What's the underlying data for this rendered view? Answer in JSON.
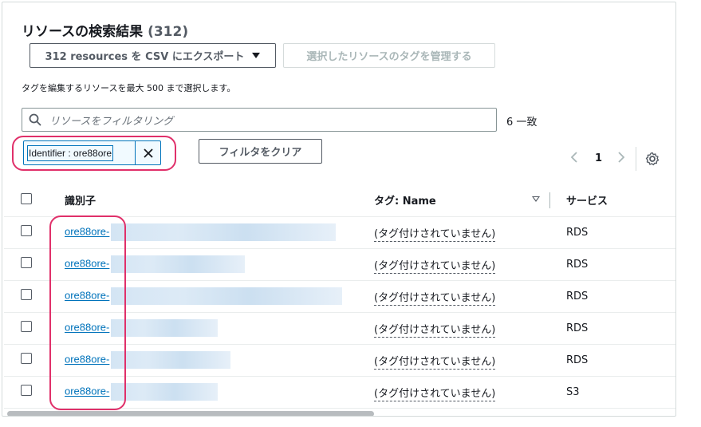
{
  "header": {
    "title": "リソースの検索結果",
    "count": "(312)"
  },
  "actions": {
    "export_label": "312 resources を CSV にエクスポート",
    "manage_tags_label": "選択したリソースのタグを管理する"
  },
  "hint": "タグを編集するリソースを最大 500 まで選択します。",
  "search": {
    "placeholder": "リソースをフィルタリング",
    "matches": "6 一致"
  },
  "filter_token": {
    "label": "Identifier : ore88ore"
  },
  "clear_filters_label": "フィルタをクリア",
  "pagination": {
    "current_page": "1",
    "prev": "‹",
    "next": "›"
  },
  "table": {
    "columns": [
      "識別子",
      "タグ: Name",
      "サービス"
    ],
    "rows": [
      {
        "id": "ore88ore-",
        "tag": "(タグ付けされていません)",
        "service": "RDS"
      },
      {
        "id": "ore88ore-",
        "tag": "(タグ付けされていません)",
        "service": "RDS"
      },
      {
        "id": "ore88ore-",
        "tag": "(タグ付けされていません)",
        "service": "RDS"
      },
      {
        "id": "ore88ore-",
        "tag": "(タグ付けされていません)",
        "service": "RDS"
      },
      {
        "id": "ore88ore-",
        "tag": "(タグ付けされていません)",
        "service": "RDS"
      },
      {
        "id": "ore88ore-",
        "tag": "(タグ付けされていません)",
        "service": "S3"
      }
    ]
  },
  "colors": {
    "link": "#0073bb",
    "highlight": "#e0306a",
    "border": "#d5dbdb"
  }
}
